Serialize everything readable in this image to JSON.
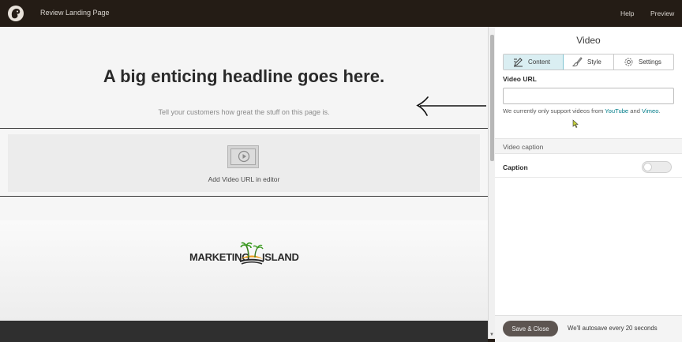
{
  "topbar": {
    "title": "Review Landing Page",
    "help": "Help",
    "preview": "Preview"
  },
  "canvas": {
    "headline": "A big enticing headline goes here.",
    "subtext": "Tell your customers how great the stuff on this page is.",
    "video_placeholder": "Add Video URL in editor",
    "brand_left": "MARKETING",
    "brand_right": "ISLAND"
  },
  "panel": {
    "title": "Video",
    "tabs": [
      {
        "label": "Content",
        "icon": "pencil-icon"
      },
      {
        "label": "Style",
        "icon": "brush-icon"
      },
      {
        "label": "Settings",
        "icon": "gear-icon"
      }
    ],
    "url_label": "Video URL",
    "url_value": "",
    "support": {
      "prefix": "We currently only support videos from ",
      "youtube": "YouTube",
      "and": " and ",
      "vimeo": "Vimeo",
      "suffix": "."
    },
    "section_header": "Video caption",
    "caption_label": "Caption",
    "caption_enabled": false
  },
  "footer": {
    "save_label": "Save & Close",
    "autosave": "We'll autosave every 20 seconds"
  },
  "colors": {
    "topbar": "#241c15",
    "accent": "#007c89",
    "tab_active": "#daeef2",
    "save_button": "#5d5551"
  }
}
